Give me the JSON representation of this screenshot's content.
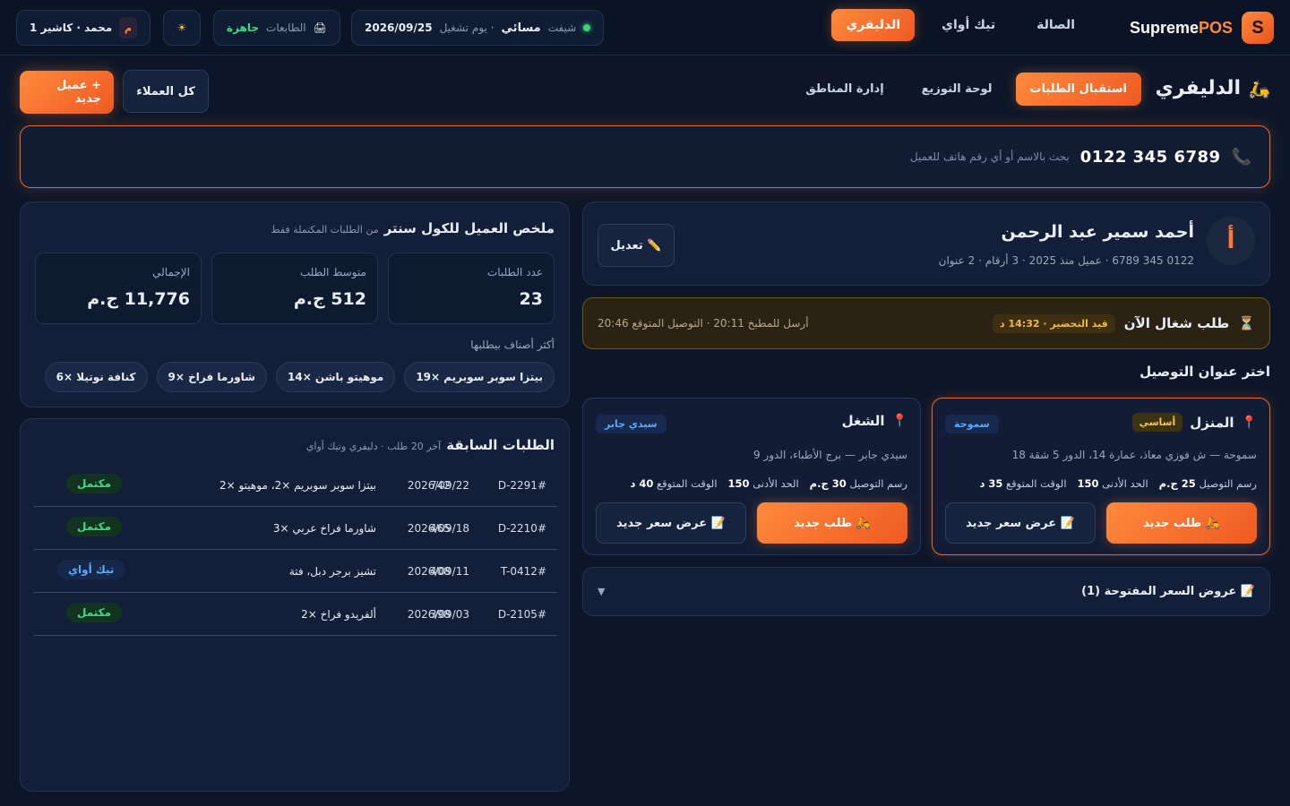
{
  "brand": {
    "name_main": "Supreme",
    "name_accent": "POS",
    "logo_letter": "S"
  },
  "top_nav": [
    {
      "label": "الصالة",
      "active": false
    },
    {
      "label": "تيك أواي",
      "active": false
    },
    {
      "label": "الدليفري",
      "active": true
    }
  ],
  "shift": {
    "label": "شيفت",
    "period": "مسائي",
    "day_label": "· يوم تشغيل",
    "date": "2026/09/25"
  },
  "printers": {
    "icon": "🖨",
    "label": "الطابعات",
    "status": "جاهزة"
  },
  "theme_icon": "☀",
  "user": {
    "avatar_letter": "م",
    "name": "محمد · كاشير 1"
  },
  "section": {
    "icon": "🛵",
    "title": "الدليفري"
  },
  "sub_tabs": [
    {
      "label": "استقبال الطلبات",
      "active": true
    },
    {
      "label": "لوحة التوزيع",
      "active": false
    },
    {
      "label": "إدارة المناطق",
      "active": false
    }
  ],
  "actions": {
    "all_customers": "كل العملاء",
    "new_customer": "+ عميل جديد"
  },
  "search": {
    "icon": "📞",
    "value": "0122 345 6789",
    "placeholder": "بحث بالاسم أو أي رقم هاتف للعميل"
  },
  "customer": {
    "avatar_letter": "أ",
    "name": "أحمد سمير عبد الرحمن",
    "meta": "0122 345 6789 · عميل منذ 2025 · 3 أرقام · 2 عنوان",
    "edit_label": "✏️ تعديل"
  },
  "active_order": {
    "icon": "⏳",
    "title": "طلب شغال الآن",
    "badge": "قيد التحضير · 14:32 د",
    "times": "أرسل للمطبخ 20:11 · التوصيل المتوقع 20:46"
  },
  "addresses_heading": "اختر عنوان التوصيل",
  "addresses": [
    {
      "title": "المنزل",
      "tag": "أساسي",
      "zone": "سموحة",
      "line": "سموحة — ش فوزي معاذ، عمارة 14، الدور 5 شقة 18",
      "fee_label": "رسم التوصيل",
      "fee": "25 ج.م",
      "min_label": "الحد الأدنى",
      "min": "150",
      "eta_label": "الوقت المتوقع",
      "eta": "35 د",
      "new_order": "🛵 طلب جديد",
      "quote": "📝 عرض سعر جديد"
    },
    {
      "title": "الشغل",
      "tag": "",
      "zone": "سيدي جابر",
      "line": "سيدي جابر — برج الأطباء، الدور 9",
      "fee_label": "رسم التوصيل",
      "fee": "30 ج.م",
      "min_label": "الحد الأدنى",
      "min": "150",
      "eta_label": "الوقت المتوقع",
      "eta": "40 د",
      "new_order": "🛵 طلب جديد",
      "quote": "📝 عرض سعر جديد"
    }
  ],
  "open_quotes": {
    "title": "📝 عروض السعر المفتوحة (1)",
    "chevron": "▼"
  },
  "summary": {
    "title": "ملخص العميل للكول سنتر",
    "subtitle": "من الطلبات المكتملة فقط",
    "stats": [
      {
        "label": "عدد الطلبات",
        "value": "23"
      },
      {
        "label": "متوسط الطلب",
        "value": "512 ج.م"
      },
      {
        "label": "الإجمالي",
        "value": "11,776 ج.م"
      }
    ],
    "favorites_label": "أكثر أصناف بيطلبها",
    "favorites": [
      "بيتزا سوبر سوبريم ×19",
      "موهيتو باشن ×14",
      "شاورما فراخ ×9",
      "كنافة نوتيلا ×6"
    ]
  },
  "orders": {
    "title": "الطلبات السابقة",
    "subtitle": "آخر 20 طلب · دليفري وتيك أواي",
    "rows": [
      {
        "id": "#D-2291",
        "date": "2026/09/22",
        "items": "بيتزا سوبر سوبريم ×2، موهيتو ×2",
        "total": "742",
        "status": "مكتمل",
        "status_type": "done"
      },
      {
        "id": "#D-2210",
        "date": "2026/09/18",
        "items": "شاورما فراخ عربي ×3",
        "total": "465",
        "status": "مكتمل",
        "status_type": "done"
      },
      {
        "id": "#T-0412",
        "date": "2026/09/11",
        "items": "تشيز برجر دبل، فتة",
        "total": "408",
        "status": "تيك أواي",
        "status_type": "take"
      },
      {
        "id": "#D-2105",
        "date": "2026/09/03",
        "items": "ألفريدو فراخ ×2",
        "total": "398",
        "status": "مكتمل",
        "status_type": "done"
      }
    ]
  },
  "colors": {
    "accent": "#ff8a3d",
    "success": "#3ddc84",
    "info": "#5aa8ff",
    "warning": "#f6b93b",
    "background": "#0d1628"
  }
}
